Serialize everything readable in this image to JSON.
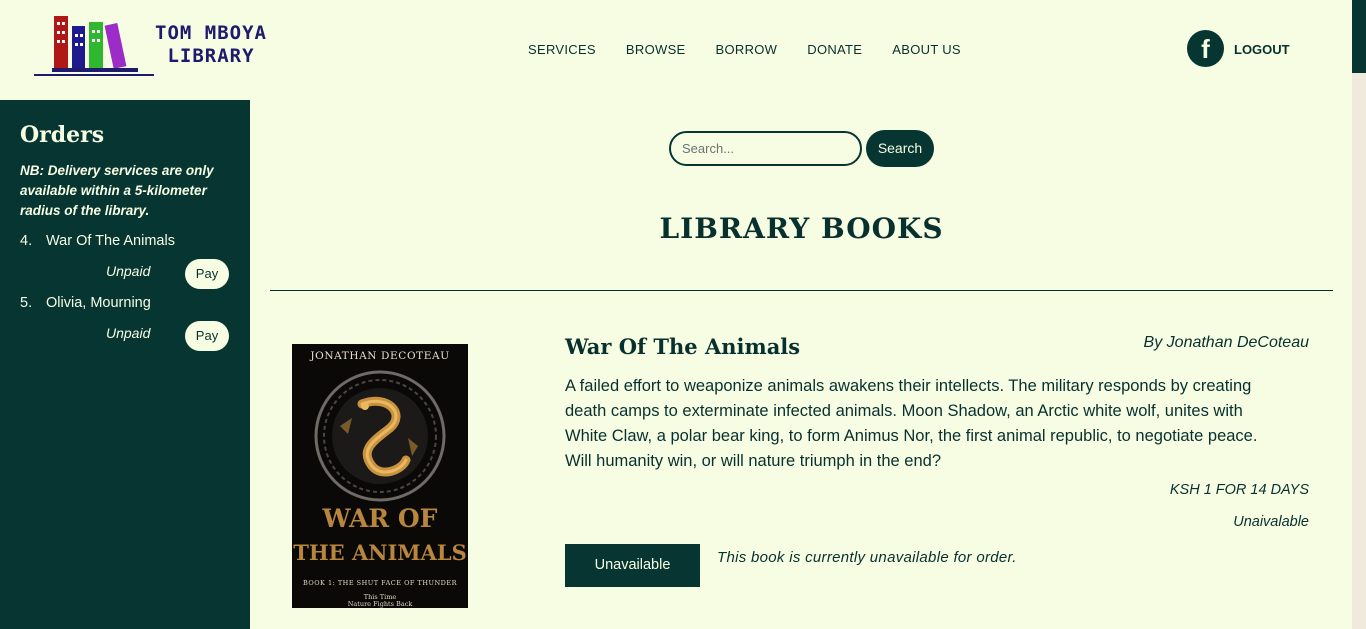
{
  "header": {
    "logo_text_line1": "TOM MBOYA",
    "logo_text_line2": "LIBRARY",
    "nav": [
      "SERVICES",
      "BROWSE",
      "BORROW",
      "DONATE",
      "ABOUT US"
    ],
    "facebook_glyph": "f",
    "logout_label": "LOGOUT"
  },
  "sidebar": {
    "title": "Orders",
    "note": "NB: Delivery services are only available within a 5-kilometer radius of the library.",
    "orders": [
      {
        "index": "4.",
        "title": "War Of The Animals",
        "status": "Unpaid",
        "pay_label": "Pay"
      },
      {
        "index": "5.",
        "title": "Olivia, Mourning",
        "status": "Unpaid",
        "pay_label": "Pay"
      }
    ]
  },
  "search": {
    "placeholder": "Search...",
    "button_label": "Search"
  },
  "main": {
    "title": "LIBRARY BOOKS"
  },
  "book": {
    "cover_author": "JONATHAN DECOTEAU",
    "cover_title_line1": "WAR OF",
    "cover_title_line2": "THE ANIMALS",
    "cover_subtitle": "BOOK 1: THE SHUT FACE OF THUNDER",
    "cover_tagline_line1": "This Time",
    "cover_tagline_line2": "Nature Fights Back",
    "title": "War Of The Animals",
    "author": "By Jonathan DeCoteau",
    "description": "A failed effort to weaponize animals awakens their intellects. The military responds by creating death camps to exterminate infected animals. Moon Shadow, an Arctic white wolf, unites with White Claw, a polar bear king, to form Animus Nor, the first animal republic, to negotiate peace. Will humanity win, or will nature triumph in the end?",
    "price": "KSH 1 FOR 14 DAYS",
    "availability": "Unaivalable",
    "button_label": "Unavailable",
    "unavailable_note": "This book is currently unavailable for order."
  },
  "colors": {
    "background": "#f7fde3",
    "primary": "#073532",
    "logo_navy": "#1e1b6e",
    "cover_gold": "#b8863d"
  }
}
